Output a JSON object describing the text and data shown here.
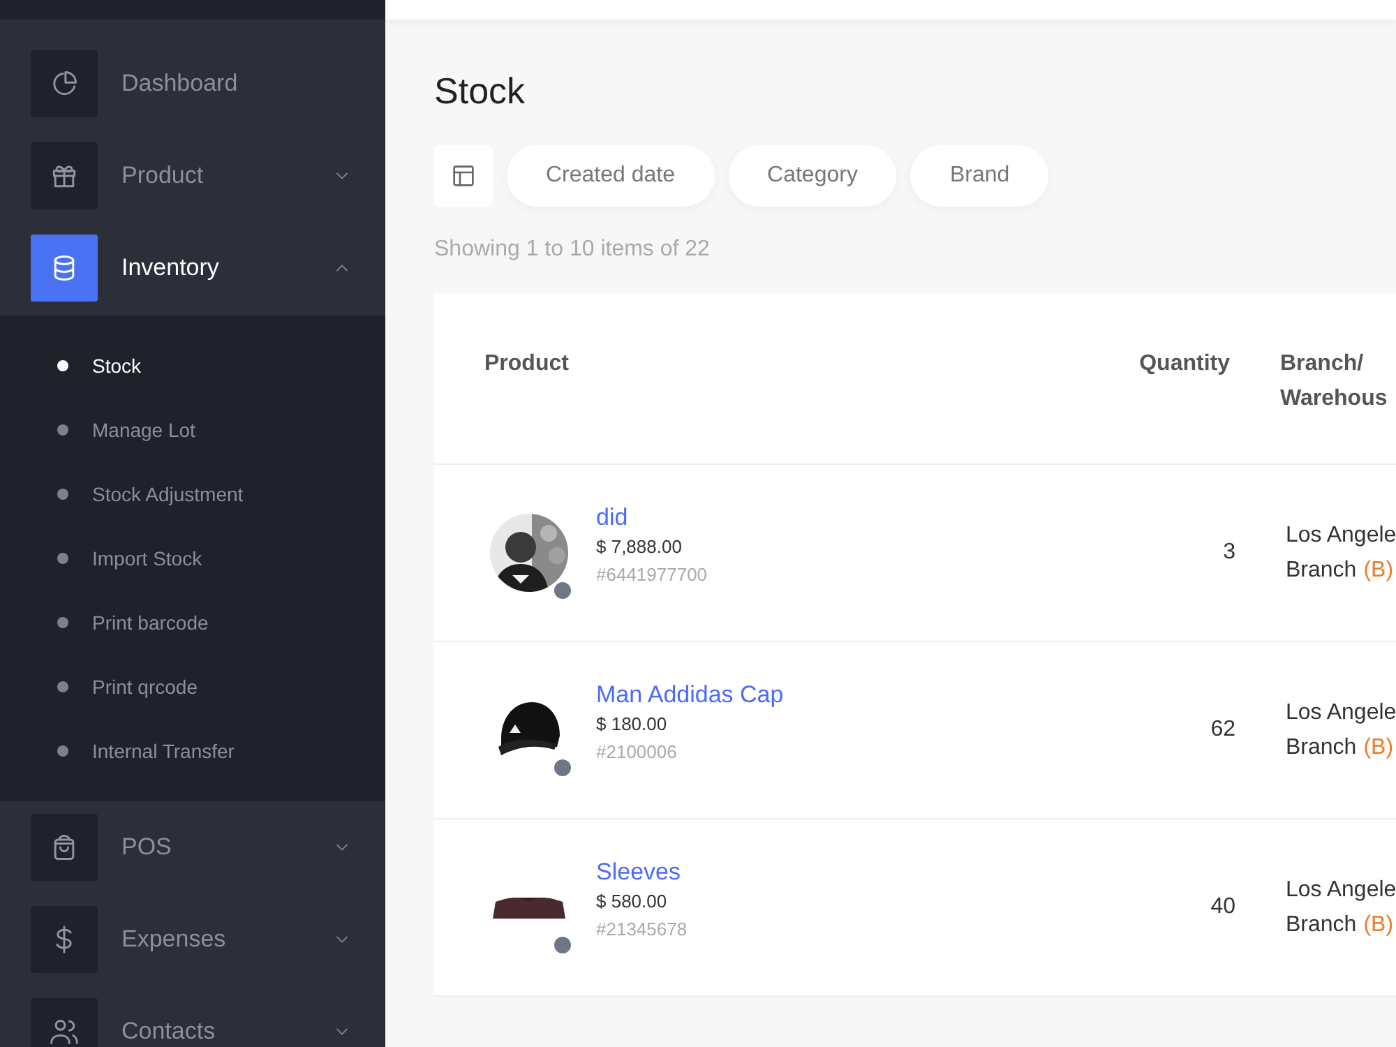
{
  "sidebar": {
    "items": [
      {
        "label": "Dashboard",
        "selected": false
      },
      {
        "label": "Product",
        "selected": false,
        "expanded": false
      },
      {
        "label": "Inventory",
        "selected": true,
        "expanded": true,
        "children": [
          {
            "label": "Stock",
            "selected": true
          },
          {
            "label": "Manage Lot",
            "selected": false
          },
          {
            "label": "Stock Adjustment",
            "selected": false
          },
          {
            "label": "Import Stock",
            "selected": false
          },
          {
            "label": "Print barcode",
            "selected": false
          },
          {
            "label": "Print qrcode",
            "selected": false
          },
          {
            "label": "Internal Transfer",
            "selected": false
          }
        ]
      },
      {
        "label": "POS",
        "selected": false,
        "expanded": false
      },
      {
        "label": "Expenses",
        "selected": false,
        "expanded": false
      },
      {
        "label": "Contacts",
        "selected": false,
        "expanded": false
      }
    ]
  },
  "page_title": "Stock",
  "filters": [
    "Created date",
    "Category",
    "Brand"
  ],
  "summary": "Showing 1 to 10 items of 22",
  "table": {
    "columns": [
      "Product",
      "Quantity",
      "Branch/ Warehous"
    ],
    "rows": [
      {
        "name": "did",
        "price": "$ 7,888.00",
        "sku": "#6441977700",
        "quantity": "3",
        "branch": "Los Angele",
        "branch_line2": "Branch",
        "branch_tag": "(B)"
      },
      {
        "name": "Man Addidas Cap",
        "price": "$ 180.00",
        "sku": "#2100006",
        "quantity": "62",
        "branch": "Los Angele",
        "branch_line2": "Branch",
        "branch_tag": "(B)"
      },
      {
        "name": "Sleeves",
        "price": "$ 580.00",
        "sku": "#21345678",
        "quantity": "40",
        "branch": "Los Angele",
        "branch_line2": "Branch",
        "branch_tag": "(B)"
      }
    ]
  }
}
